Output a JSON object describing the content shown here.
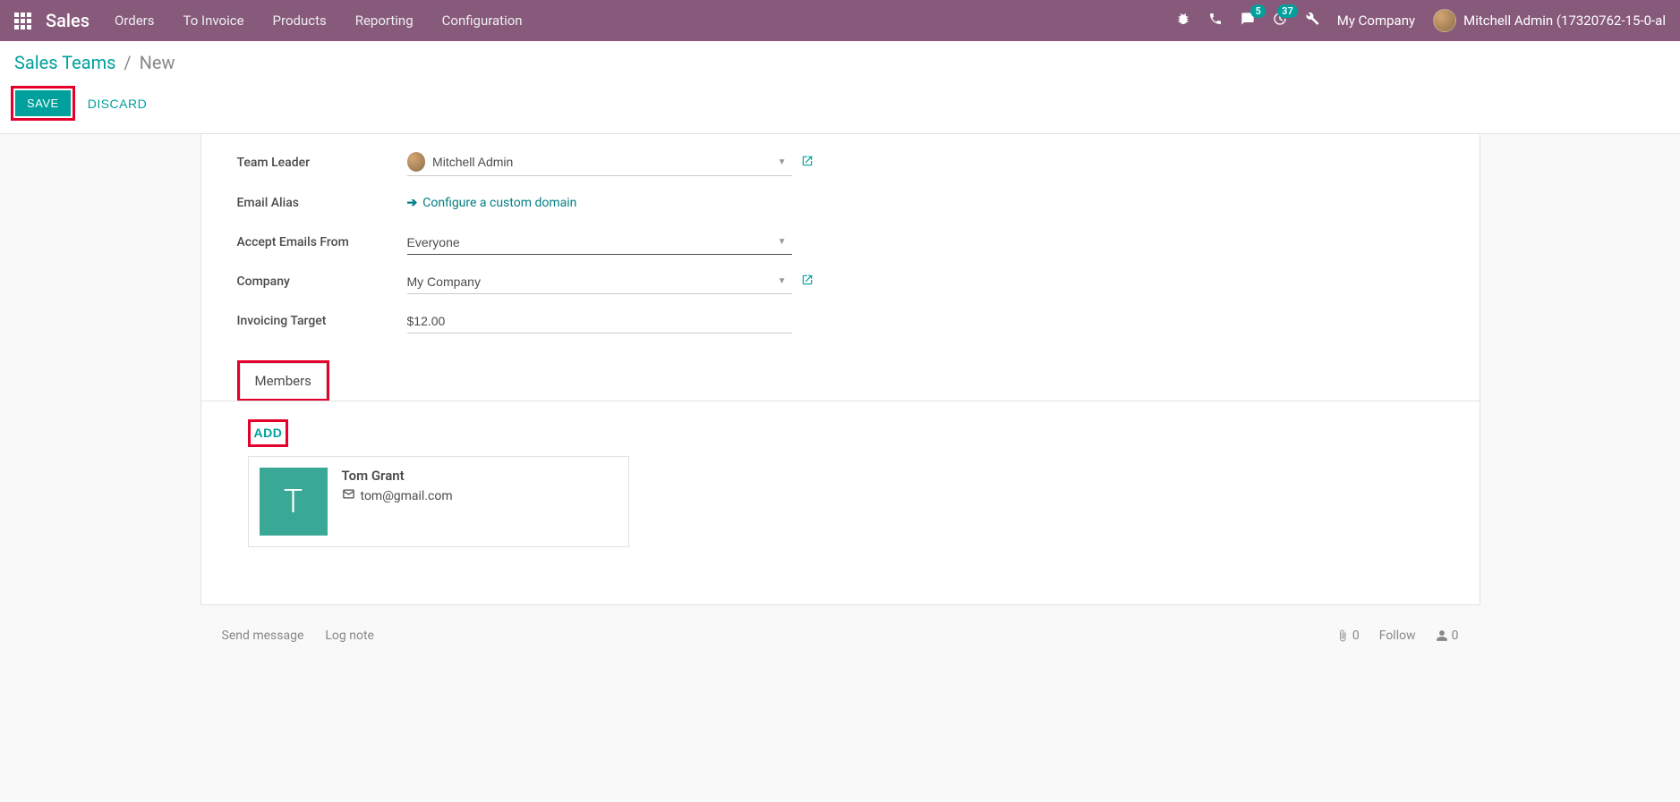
{
  "nav": {
    "brand": "Sales",
    "menu": [
      "Orders",
      "To Invoice",
      "Products",
      "Reporting",
      "Configuration"
    ],
    "msg_badge": "5",
    "clock_badge": "37",
    "company": "My Company",
    "user": "Mitchell Admin (17320762-15-0-al"
  },
  "breadcrumb": {
    "root": "Sales Teams",
    "current": "New"
  },
  "actions": {
    "save": "SAVE",
    "discard": "DISCARD"
  },
  "form": {
    "team_leader_label": "Team Leader",
    "team_leader_value": "Mitchell Admin",
    "email_alias_label": "Email Alias",
    "configure_link": "Configure a custom domain",
    "accept_label": "Accept Emails From",
    "accept_value": "Everyone",
    "company_label": "Company",
    "company_value": "My Company",
    "invoicing_label": "Invoicing Target",
    "invoicing_value": "$12.00"
  },
  "tabs": {
    "members": "Members"
  },
  "members": {
    "add": "ADD",
    "card": {
      "initial": "T",
      "name": "Tom Grant",
      "email": "tom@gmail.com"
    }
  },
  "chatter": {
    "send": "Send message",
    "log": "Log note",
    "attach_count": "0",
    "follow": "Follow",
    "follower_count": "0"
  }
}
